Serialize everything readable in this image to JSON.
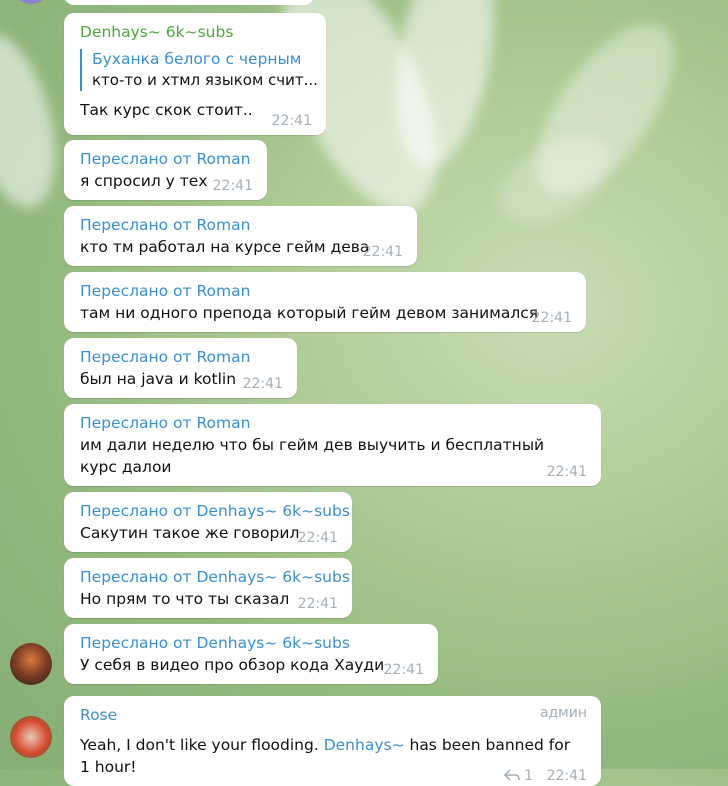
{
  "messages": [
    {
      "sender": "Denhays~ 6k~subs",
      "reply_to": {
        "name": "Буханка белого с черным",
        "text": "кто-то и хтмл языком счит..."
      },
      "text": "Так курс скок стоит..",
      "time": "22:41"
    },
    {
      "forwarded": "Переслано от Roman",
      "text": "я спросил у тех",
      "time": "22:41"
    },
    {
      "forwarded": "Переслано от Roman",
      "text": "кто тм работал на курсе гейм дева",
      "time": "22:41"
    },
    {
      "forwarded": "Переслано от Roman",
      "text": "там ни одного препода который гейм девом занимался",
      "time": "22:41"
    },
    {
      "forwarded": "Переслано от Roman",
      "text": "был на java и kotlin",
      "time": "22:41"
    },
    {
      "forwarded": "Переслано от Roman",
      "text": "им дали неделю что бы гейм дев выучить и бесплатный курс далои",
      "time": "22:41"
    },
    {
      "forwarded": "Переслано от Denhays~ 6k~subs",
      "text": "Сакутин такое же говорил",
      "time": "22:41"
    },
    {
      "forwarded": "Переслано от Denhays~ 6k~subs",
      "text": "Но прям то что ты сказал",
      "time": "22:41"
    },
    {
      "forwarded": "Переслано от Denhays~ 6k~subs",
      "text": "У себя в видео про обзор кода Хауди",
      "time": "22:41"
    },
    {
      "sender": "Rose",
      "badge": "админ",
      "text_before": "Yeah, I don't like your flooding. ",
      "mention": "Denhays~",
      "text_after": " has been banned for 1 hour!",
      "replies": "1",
      "time": "22:41"
    }
  ],
  "icons": {
    "reply": "reply-arrow-icon"
  }
}
